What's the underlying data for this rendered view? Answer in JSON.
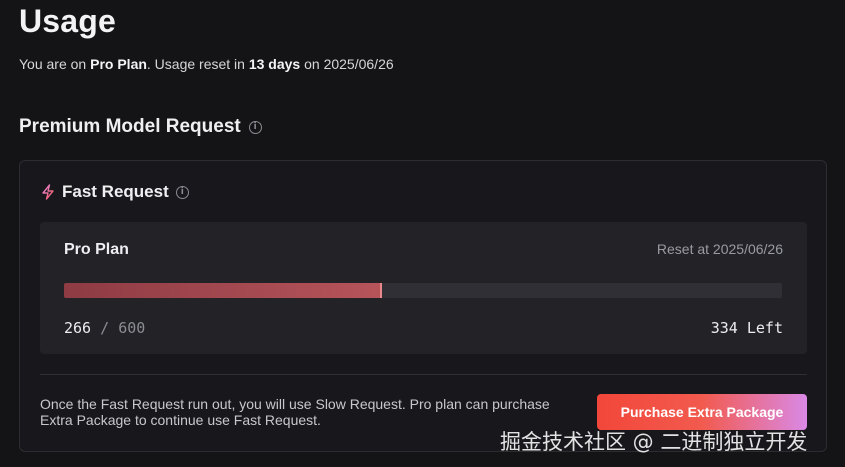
{
  "page": {
    "title": "Usage",
    "summary": {
      "prefix": "You are on ",
      "plan": "Pro Plan",
      "middle": ". Usage reset in ",
      "days": "13 days",
      "suffix": " on 2025/06/26"
    }
  },
  "premium": {
    "title": "Premium Model Request",
    "info_icon": "i"
  },
  "fast_request": {
    "title": "Fast Request",
    "icon": "lightning-bolt-icon",
    "info_icon": "i",
    "plan": {
      "name": "Pro Plan",
      "reset_label": "Reset at 2025/06/26",
      "used": "266",
      "separator": "/",
      "total": "600",
      "progress_fraction": 0.443,
      "left_label": "334 Left"
    },
    "footnote": "Once the Fast Request run out, you will use Slow Request. Pro plan can purchase Extra Package to continue use Fast Request.",
    "purchase_button": "Purchase Extra Package"
  },
  "colors": {
    "background": "#141417",
    "progress_fill": "#b6545a",
    "button_start": "#f2473a",
    "button_end": "#d989e6"
  },
  "watermark": "掘金技术社区 @ 二进制独立开发"
}
